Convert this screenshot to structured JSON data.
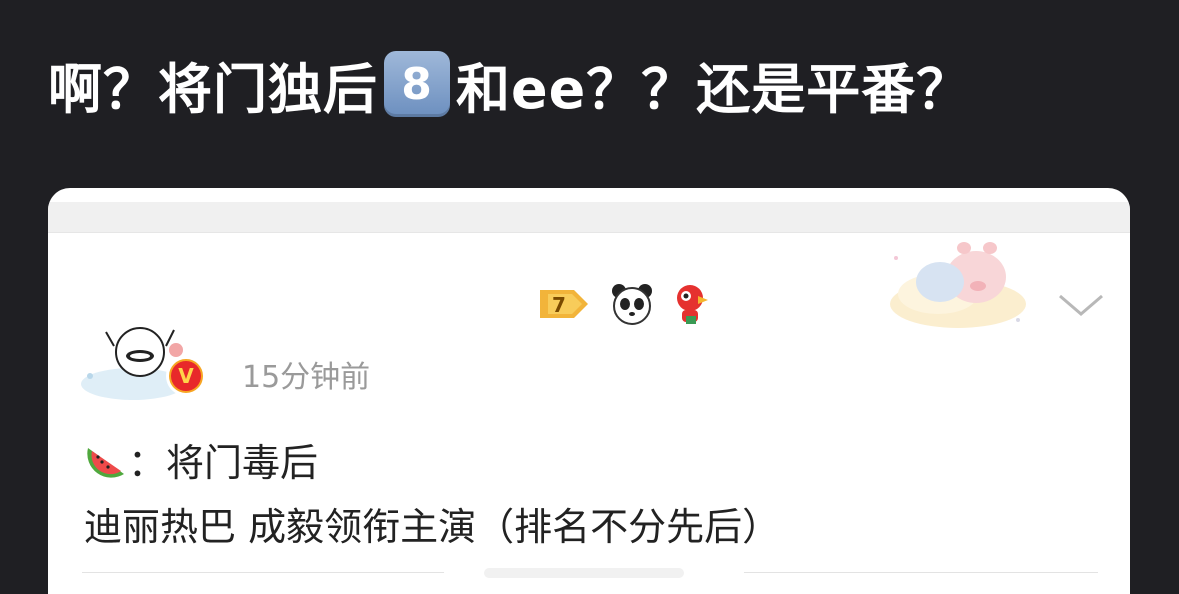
{
  "headline": {
    "part1": "啊？将门独后",
    "badge": "8",
    "part2": "和ee？？还是平番？"
  },
  "post": {
    "timestamp": "15分钟前",
    "line1_text": "：将门毒后",
    "line2_text": "迪丽热巴 成毅领衔主演（排名不分先后）",
    "verified_badge": "V"
  },
  "icons": {
    "badge_1": "level-arrow-icon",
    "badge_2": "panda-icon",
    "badge_3": "parrot-icon",
    "watermelon": "watermelon-icon",
    "chevron": "chevron-down-icon"
  },
  "colors": {
    "background": "#1f1f23",
    "card": "#ffffff",
    "timestamp": "#9a9a9a",
    "verified": "#f7a623"
  }
}
